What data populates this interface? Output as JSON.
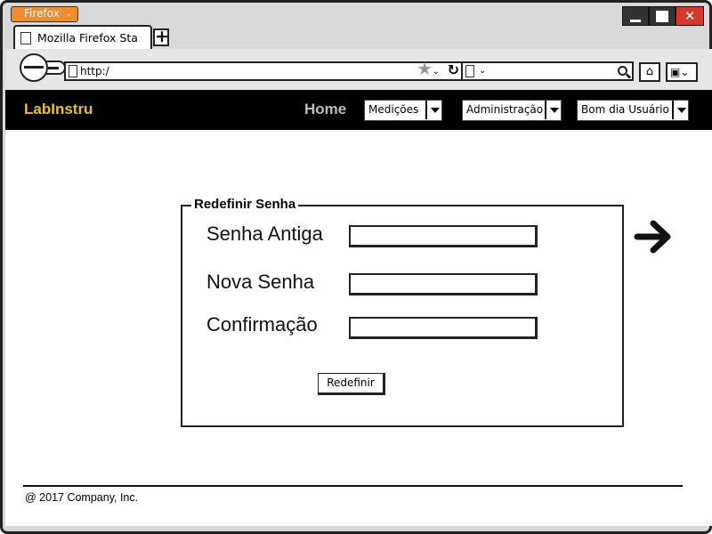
{
  "browser": {
    "menu_button_label": "Firefox",
    "tab_title": "Mozilla Firefox Sta",
    "new_tab_label": "+",
    "url": "http:/",
    "close_label": "✕"
  },
  "site": {
    "brand": "LabInstru",
    "nav": {
      "home": "Home",
      "dropdowns": [
        {
          "label": "Medições"
        },
        {
          "label": "Administração"
        },
        {
          "label": "Bom dia Usuário"
        }
      ]
    }
  },
  "form": {
    "legend": "Redefinir Senha",
    "fields": [
      {
        "label": "Senha Antiga",
        "value": ""
      },
      {
        "label": "Nova Senha",
        "value": ""
      },
      {
        "label": "Confirmação",
        "value": ""
      }
    ],
    "submit_label": "Redefinir"
  },
  "footer": {
    "copyright": "@ 2017 Company, Inc."
  },
  "colors": {
    "brand": "#f0c020",
    "nav_background": "#000000",
    "firefox_button": "#f08c2a",
    "close_button": "#d8382b"
  },
  "icons": {
    "next": "arrow-right-icon",
    "home": "home-icon",
    "search": "magnifier-icon",
    "bookmark": "bookmark-icon"
  }
}
